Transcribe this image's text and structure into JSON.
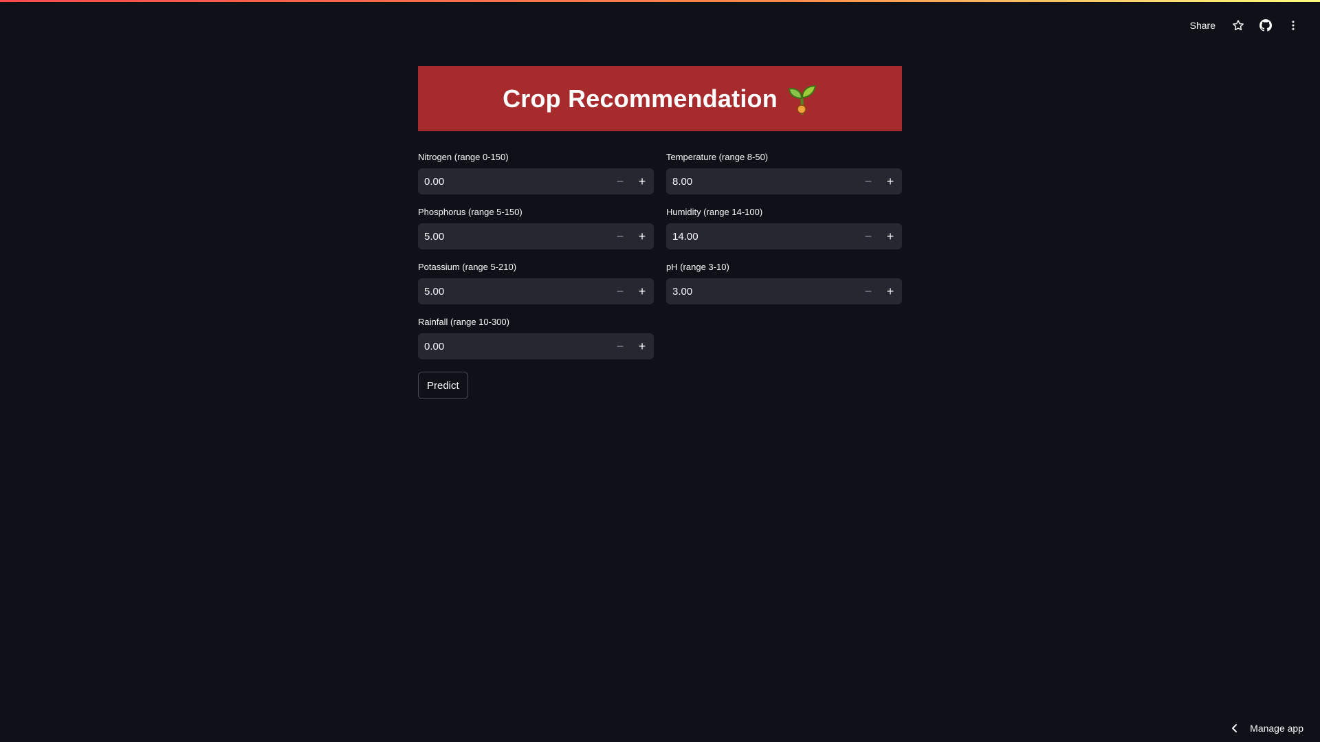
{
  "toolbar": {
    "share_label": "Share"
  },
  "banner": {
    "title": "Crop Recommendation"
  },
  "fields": [
    {
      "label": "Nitrogen (range 0-150)",
      "value": "0.00"
    },
    {
      "label": "Temperature (range 8-50)",
      "value": "8.00"
    },
    {
      "label": "Phosphorus (range 5-150)",
      "value": "5.00"
    },
    {
      "label": "Humidity (range 14-100)",
      "value": "14.00"
    },
    {
      "label": "Potassium (range 5-210)",
      "value": "5.00"
    },
    {
      "label": "pH (range 3-10)",
      "value": "3.00"
    },
    {
      "label": "Rainfall (range 10-300)",
      "value": "0.00"
    }
  ],
  "predict_label": "Predict",
  "footer": {
    "manage_label": "Manage app"
  },
  "colors": {
    "banner": "#a72a2c",
    "background": "#0e1117",
    "input_bg": "#262730"
  },
  "icons": [
    "seedling-icon",
    "star-icon",
    "github-icon",
    "more-vert-icon",
    "chevron-left-icon",
    "minus-icon",
    "plus-icon"
  ]
}
